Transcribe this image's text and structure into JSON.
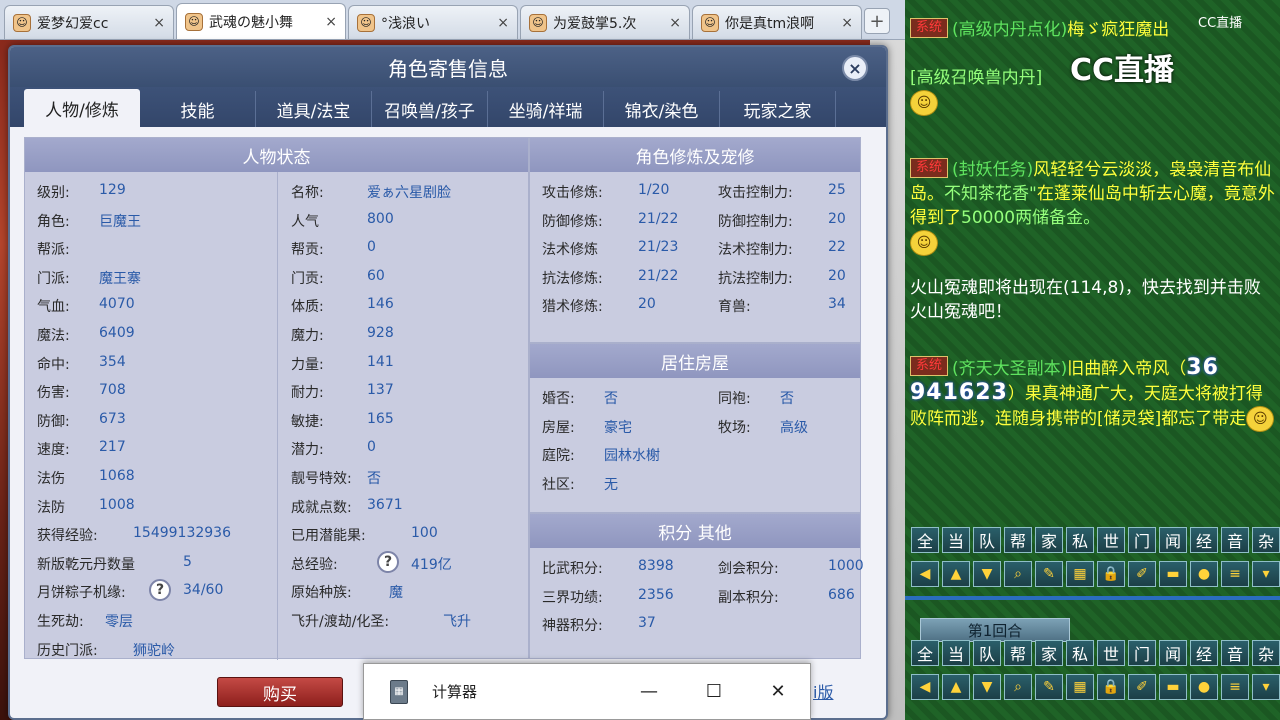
{
  "browser_tabs": [
    {
      "label": "爱梦幻爱cc",
      "active": false
    },
    {
      "label": "武魂の魅小舞",
      "active": true
    },
    {
      "label": "°浅浪い",
      "active": false
    },
    {
      "label": "为爱鼓掌5.次",
      "active": false
    },
    {
      "label": "你是真tm浪啊",
      "active": false
    }
  ],
  "new_tab": "+",
  "tab_close": "×",
  "dialog": {
    "title": "角色寄售信息",
    "close_label": "×",
    "tabs": [
      "人物/修炼",
      "技能",
      "道具/法宝",
      "召唤兽/孩子",
      "坐骑/祥瑞",
      "锦衣/染色",
      "玩家之家"
    ],
    "active_tab": "人物/修炼",
    "status_title": "人物状态",
    "status_left": [
      {
        "label": "级别:",
        "value": "129"
      },
      {
        "label": "角色:",
        "value": "巨魔王"
      },
      {
        "label": "帮派:",
        "value": ""
      },
      {
        "label": "门派:",
        "value": "魔王寨"
      },
      {
        "label": "气血:",
        "value": "4070"
      },
      {
        "label": "魔法:",
        "value": "6409"
      },
      {
        "label": "命中:",
        "value": "354"
      },
      {
        "label": "伤害:",
        "value": "708"
      },
      {
        "label": "防御:",
        "value": "673"
      },
      {
        "label": "速度:",
        "value": "217"
      },
      {
        "label": "法伤",
        "value": "1068"
      },
      {
        "label": "法防",
        "value": "1008"
      }
    ],
    "status_right": [
      {
        "label": "名称:",
        "value": "爱ぁ六星剧脸"
      },
      {
        "label": "人气",
        "value": "800"
      },
      {
        "label": "帮贡:",
        "value": "0"
      },
      {
        "label": "门贡:",
        "value": "60"
      },
      {
        "label": "体质:",
        "value": "146"
      },
      {
        "label": "魔力:",
        "value": "928"
      },
      {
        "label": "力量:",
        "value": "141"
      },
      {
        "label": "耐力:",
        "value": "137"
      },
      {
        "label": "敏捷:",
        "value": "165"
      },
      {
        "label": "潜力:",
        "value": "0"
      },
      {
        "label": "靓号特效:",
        "value": "否"
      },
      {
        "label": "成就点数:",
        "value": "3671"
      }
    ],
    "exp_label": "获得经验:",
    "exp_value": "15499132936",
    "qianyuan_label": "新版乾元丹数量",
    "qianyuan_value": "5",
    "mooncake_label": "月饼粽子机缘:",
    "mooncake_value": "34/60",
    "shengsi_label": "生死劫:",
    "shengsi_value": "零层",
    "history_label": "历史门派:",
    "history_value": "狮驼岭",
    "potential_fruit_label": "已用潜能果:",
    "potential_fruit_value": "100",
    "total_exp_label": "总经验:",
    "total_exp_value": "419亿",
    "origin_label": "原始种族:",
    "origin_value": "魔",
    "ascend_label": "飞升/渡劫/化圣:",
    "ascend_value": "飞升",
    "help_icon": "?",
    "cultivation_title": "角色修炼及宠修",
    "cultivation": [
      {
        "label": "攻击修炼:",
        "value": "1/20",
        "label2": "攻击控制力:",
        "value2": "25"
      },
      {
        "label": "防御修炼:",
        "value": "21/22",
        "label2": "防御控制力:",
        "value2": "20"
      },
      {
        "label": "法术修炼",
        "value": "21/23",
        "label2": "法术控制力:",
        "value2": "22"
      },
      {
        "label": "抗法修炼:",
        "value": "21/22",
        "label2": "抗法控制力:",
        "value2": "20"
      },
      {
        "label": "猎术修炼:",
        "value": "20",
        "label2": "育兽:",
        "value2": "34"
      }
    ],
    "house_title": "居住房屋",
    "house": [
      {
        "label": "婚否:",
        "value": "否",
        "label2": "同袍:",
        "value2": "否"
      },
      {
        "label": "房屋:",
        "value": "豪宅",
        "label2": "牧场:",
        "value2": "高级"
      },
      {
        "label": "庭院:",
        "value": "园林水榭",
        "label2": "",
        "value2": ""
      },
      {
        "label": "社区:",
        "value": "无",
        "label2": "",
        "value2": ""
      }
    ],
    "points_title": "积分 其他",
    "points": [
      {
        "label": "比武积分:",
        "value": "8398",
        "label2": "剑会积分:",
        "value2": "1000"
      },
      {
        "label": "三界功绩:",
        "value": "2356",
        "label2": "副本积分:",
        "value2": "686"
      },
      {
        "label": "神器积分:",
        "value": "37",
        "label2": "",
        "value2": ""
      }
    ],
    "buy_button": "购买",
    "link_partial": "i版"
  },
  "calculator": {
    "title": "计算器",
    "minimize": "—",
    "maximize": "☐",
    "close": "✕"
  },
  "chat": {
    "cc_top": "CC直播",
    "cc_logo": "CC直播",
    "system_badge": "系统",
    "msg1_head": "(高级内丹点化)",
    "msg1_body": "梅ゞ疯狂魔出",
    "msg1_tail": "[高级召唤兽内丹]",
    "msg2_head": "(封妖任务)",
    "msg2_body": "风轻轻兮云淡淡，袅袅清音布仙岛。",
    "msg2_name": "不知茶花香\"",
    "msg2_tail": "在蓬莱仙岛中斩去心魔，竟意外得到了",
    "msg2_reward": "50000两储备金。",
    "msg3": "火山冤魂即将出现在(114,8)，快去找到并击败火山冤魂吧！",
    "msg4_head": "(齐天大圣副本)",
    "msg4_body": "旧曲醉入帝风（",
    "msg4_num_right": "36",
    "msg4_num": "941623",
    "msg4_tail": "）果真神通广大，天庭大将被打得败阵而逃，连随身携带的[储灵袋]都忘了带走",
    "channel_buttons": [
      "全",
      "当",
      "队",
      "帮",
      "家",
      "私",
      "世",
      "门",
      "闻",
      "经",
      "音",
      "杂"
    ],
    "tool_icons": [
      "arrow-left-icon",
      "arrow-up-icon",
      "arrow-down-icon",
      "magnifier-icon",
      "note-icon",
      "grid-icon",
      "lock-icon",
      "brush-icon",
      "folder-icon",
      "speech-icon",
      "list-add-icon",
      "dropdown-icon"
    ],
    "round_label": "第1回合"
  }
}
